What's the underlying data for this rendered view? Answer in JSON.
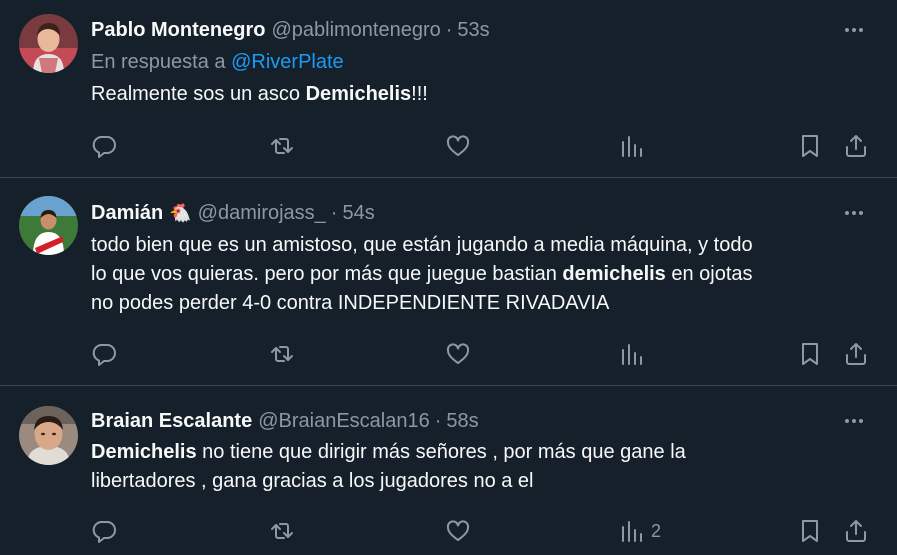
{
  "tweets": [
    {
      "name": "Pablo Montenegro",
      "name_emoji": "",
      "handle": "@pablimontenegro",
      "dot": "·",
      "time": "53s",
      "reply_prefix": "En respuesta a",
      "reply_to": "@RiverPlate",
      "text_parts": [
        "Realmente sos un asco ",
        "Demichelis",
        "!!!"
      ],
      "views": "",
      "avatar_colors": {
        "bg": "#c44b55",
        "skin": "#e9b89a",
        "hair": "#3a2418"
      }
    },
    {
      "name": "Damián",
      "name_emoji": "🐔",
      "handle": "@damirojass_",
      "dot": "·",
      "time": "54s",
      "text_lines": [
        "todo bien que es un amistoso, que están jugando a media máquina, y todo",
        "lo que vos quieras. pero por más que juegue bastian ",
        "demichelis",
        " en ojotas",
        "no podes perder 4-0 contra INDEPENDIENTE RIVADAVIA"
      ],
      "views": "",
      "avatar_colors": {
        "bg": "#3d7a3a",
        "skin": "#c98e6a",
        "shirt": "#ffffff",
        "band": "#d0202a"
      }
    },
    {
      "name": "Braian Escalante",
      "name_emoji": "",
      "handle": "@BraianEscalan16",
      "dot": "·",
      "time": "58s",
      "text_parts": [
        "Demichelis",
        " no tiene que dirigir más señores , por más que gane la libertadores , gana gracias a los jugadores no a el"
      ],
      "text_line2": "libertadores , gana gracias a los jugadores no a el",
      "views": "2",
      "avatar_colors": {
        "bg": "#9a8a80",
        "skin": "#d8a888",
        "hair": "#2a1c14"
      }
    }
  ],
  "icons": {
    "more": "more-dots-icon",
    "reply": "reply-icon",
    "retweet": "retweet-icon",
    "like": "heart-icon",
    "views": "views-chart-icon",
    "bookmark": "bookmark-icon",
    "share": "share-icon"
  },
  "colors": {
    "background": "#15202b",
    "divider": "#38444d",
    "text_primary": "#f7f9f9",
    "text_secondary": "#8b98a5",
    "link": "#1d9bf0"
  }
}
